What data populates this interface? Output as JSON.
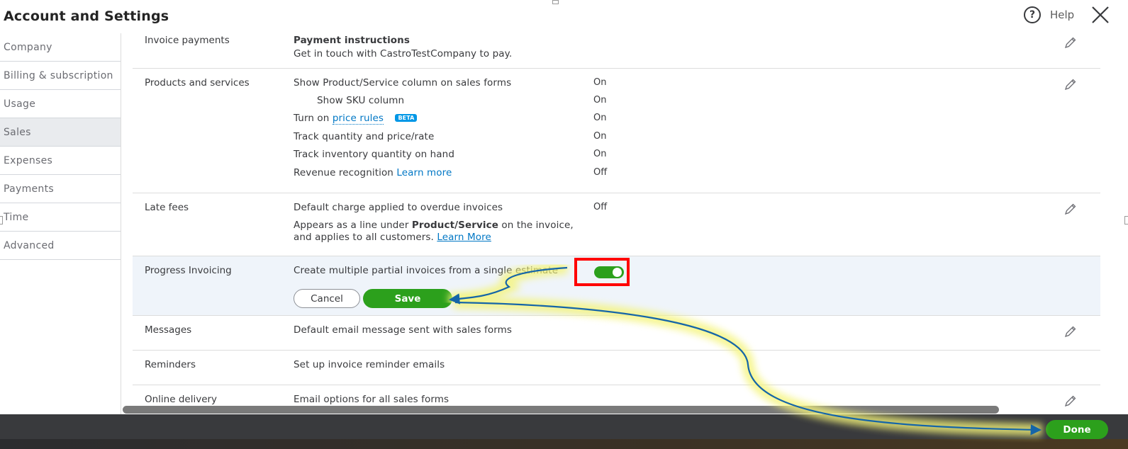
{
  "header": {
    "title": "Account and Settings",
    "help_icon": "?",
    "help_label": "Help"
  },
  "sidebar": {
    "items": [
      {
        "label": "Company"
      },
      {
        "label": "Billing & subscription"
      },
      {
        "label": "Usage"
      },
      {
        "label": "Sales",
        "active": true
      },
      {
        "label": "Expenses"
      },
      {
        "label": "Payments"
      },
      {
        "label": "Time"
      },
      {
        "label": "Advanced"
      }
    ]
  },
  "sections": {
    "invoice_payments": {
      "label": "Invoice payments",
      "heading": "Payment instructions",
      "text": "Get in touch with CastroTestCompany to pay."
    },
    "products_services": {
      "label": "Products and services",
      "settings": [
        {
          "text": "Show Product/Service column on sales forms",
          "value": "On"
        },
        {
          "text": "Show SKU column",
          "value": "On"
        },
        {
          "prefix": "Turn on",
          "link": "price rules",
          "badge": "BETA",
          "value": "On"
        },
        {
          "text": "Track quantity and price/rate",
          "value": "On"
        },
        {
          "text": "Track inventory quantity on hand",
          "value": "On"
        },
        {
          "prefix": "Revenue recognition",
          "link": "Learn more",
          "value": "Off"
        }
      ]
    },
    "late_fees": {
      "label": "Late fees",
      "text": "Default charge applied to overdue invoices",
      "value": "Off",
      "desc_before": "Appears as a line under",
      "desc_bold": "Product/Service",
      "desc_after": "on the invoice,",
      "desc_line2": "and applies to all customers.",
      "link": "Learn More"
    },
    "progress_invoicing": {
      "label": "Progress Invoicing",
      "text": "Create multiple partial invoices from a single estimate",
      "toggle_on": true,
      "cancel_label": "Cancel",
      "save_label": "Save"
    },
    "messages": {
      "label": "Messages",
      "text": "Default email message sent with sales forms"
    },
    "reminders": {
      "label": "Reminders",
      "text": "Set up invoice reminder emails"
    },
    "online_delivery": {
      "label": "Online delivery",
      "text": "Email options for all sales forms"
    }
  },
  "footer": {
    "done_label": "Done"
  },
  "colors": {
    "accent_green": "#2ca01c",
    "link_blue": "#0077c5",
    "annotation_red": "#ff0000",
    "annotation_arrow": "#1565a8",
    "annotation_glow": "#f4f47a"
  },
  "icons": [
    "help-icon",
    "close-icon",
    "pencil-icon"
  ]
}
